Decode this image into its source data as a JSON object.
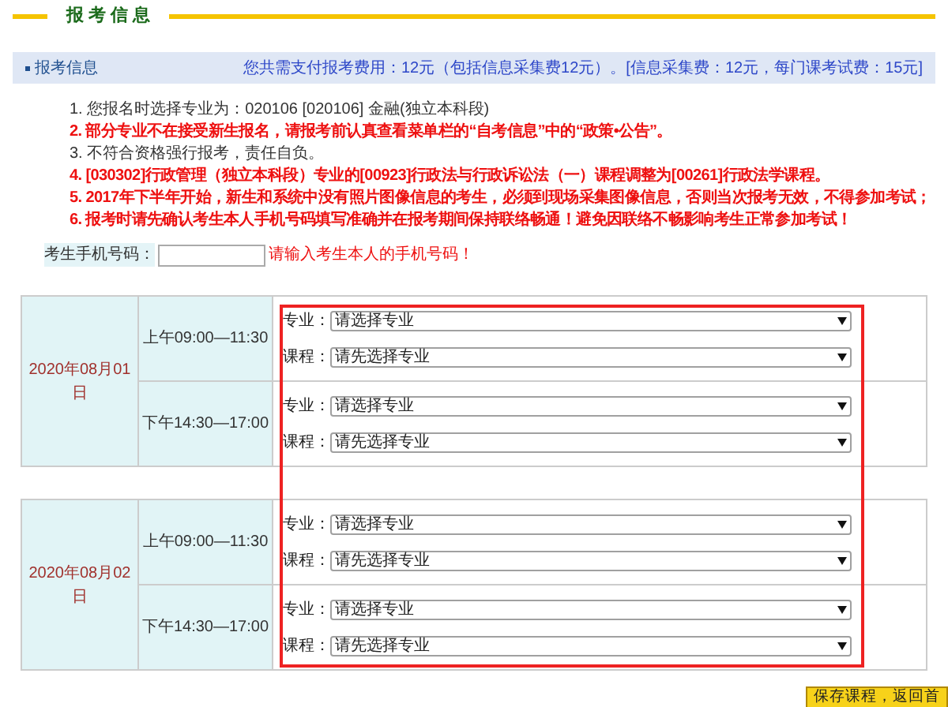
{
  "page_title": "报 考 信 息",
  "info_bar": {
    "label": "报考信息",
    "fee_summary": "您共需支付报考费用：12元（包括信息采集费12元）。[信息采集费：12元，每门课考试费：15元]"
  },
  "notices": [
    {
      "text": "1. 您报名时选择专业为：020106 [020106] 金融(独立本科段)",
      "important": false
    },
    {
      "text": "2. 部分专业不在接受新生报名，请报考前认真查看菜单栏的“自考信息”中的“政策•公告”。",
      "important": true
    },
    {
      "text": "3. 不符合资格强行报考，责任自负。",
      "important": false
    },
    {
      "text": "4. [030302]行政管理（独立本科段）专业的[00923]行政法与行政诉讼法（一）课程调整为[00261]行政法学课程。",
      "important": true
    },
    {
      "text": "5. 2017年下半年开始，新生和系统中没有照片图像信息的考生，必须到现场采集图像信息，否则当次报考无效，不得参加考试；",
      "important": true
    },
    {
      "text": "6. 报考时请先确认考生本人手机号码填写准确并在报考期间保持联络畅通！避免因联络不畅影响考生正常参加考试！",
      "important": true
    }
  ],
  "phone": {
    "label": "考生手机号码：",
    "hint": "请输入考生本人的手机号码！"
  },
  "exam_days": [
    {
      "date": "2020年08月01日",
      "sessions": [
        {
          "time": "上午09:00—11:30",
          "fields": [
            {
              "label": "专业：",
              "value": "请选择专业"
            },
            {
              "label": "课程：",
              "value": "请先选择专业"
            }
          ]
        },
        {
          "time": "下午14:30—17:00",
          "fields": [
            {
              "label": "专业：",
              "value": "请选择专业"
            },
            {
              "label": "课程：",
              "value": "请先选择专业"
            }
          ]
        }
      ]
    },
    {
      "date": "2020年08月02日",
      "sessions": [
        {
          "time": "上午09:00—11:30",
          "fields": [
            {
              "label": "专业：",
              "value": "请选择专业"
            },
            {
              "label": "课程：",
              "value": "请先选择专业"
            }
          ]
        },
        {
          "time": "下午14:30—17:00",
          "fields": [
            {
              "label": "专业：",
              "value": "请选择专业"
            },
            {
              "label": "课程：",
              "value": "请先选择专业"
            }
          ]
        }
      ]
    }
  ],
  "save_button": "保存课程，返回首"
}
